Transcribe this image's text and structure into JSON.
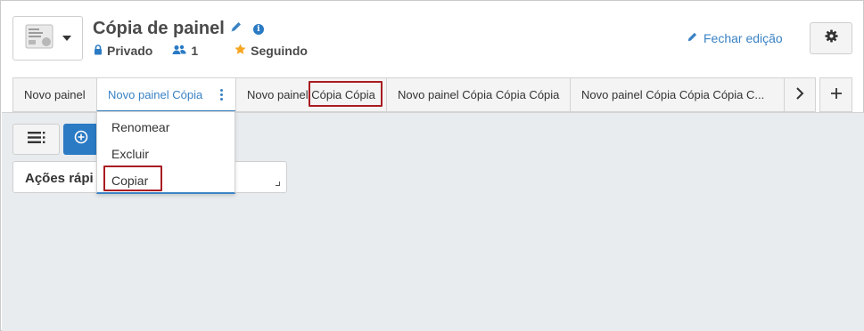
{
  "header": {
    "title": "Cópia de painel",
    "privacy": "Privado",
    "members": "1",
    "follow_status": "Seguindo",
    "close_edit": "Fechar edição"
  },
  "tabs": [
    {
      "label": "Novo painel"
    },
    {
      "label": "Novo painel Cópia",
      "active": true
    },
    {
      "label": "Novo painel Cópia Cópia"
    },
    {
      "label": "Novo painel Cópia Cópia Cópia"
    },
    {
      "label": "Novo painel Cópia Cópia Cópia C..."
    }
  ],
  "tab_menu": {
    "items": [
      "Renomear",
      "Excluir",
      "Copiar"
    ]
  },
  "widget": {
    "title": "Ações rápi"
  },
  "icons": {
    "logo": "dashboard-thumbnail-icon",
    "edit": "pencil-icon",
    "info": "info-icon",
    "privacy": "lock-icon",
    "members": "users-icon",
    "follow": "star-icon",
    "settings": "gear-icon",
    "scroll": "chevron-right-icon",
    "add_tab": "plus-icon",
    "list": "list-icon",
    "add": "plus-circle-icon"
  },
  "colors": {
    "accent": "#3a82c4",
    "primary_button": "#2a7ac4",
    "star": "#f5a623",
    "highlight_box": "#a81c22",
    "canvas": "#e8ecef"
  }
}
